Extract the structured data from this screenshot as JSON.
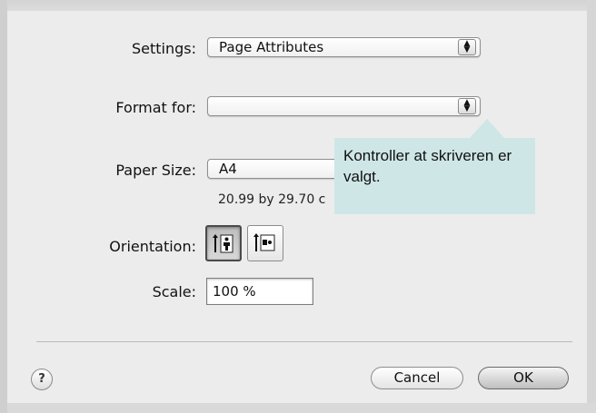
{
  "settings": {
    "label": "Settings:",
    "value": "Page Attributes"
  },
  "format_for": {
    "label": "Format for:",
    "value": ""
  },
  "paper_size": {
    "label": "Paper Size:",
    "value": "A4",
    "dimensions": "20.99 by 29.70 c"
  },
  "orientation": {
    "label": "Orientation:",
    "selected": "portrait"
  },
  "scale": {
    "label": "Scale:",
    "value": "100 %"
  },
  "footer": {
    "help": "?",
    "cancel": "Cancel",
    "ok": "OK"
  },
  "callout": {
    "text": "Kontroller at skriveren er valgt."
  },
  "icons": {
    "popup_arrows": "up-down-arrows-icon",
    "portrait": "portrait-orientation-icon",
    "landscape": "landscape-orientation-icon",
    "help": "help-icon"
  }
}
